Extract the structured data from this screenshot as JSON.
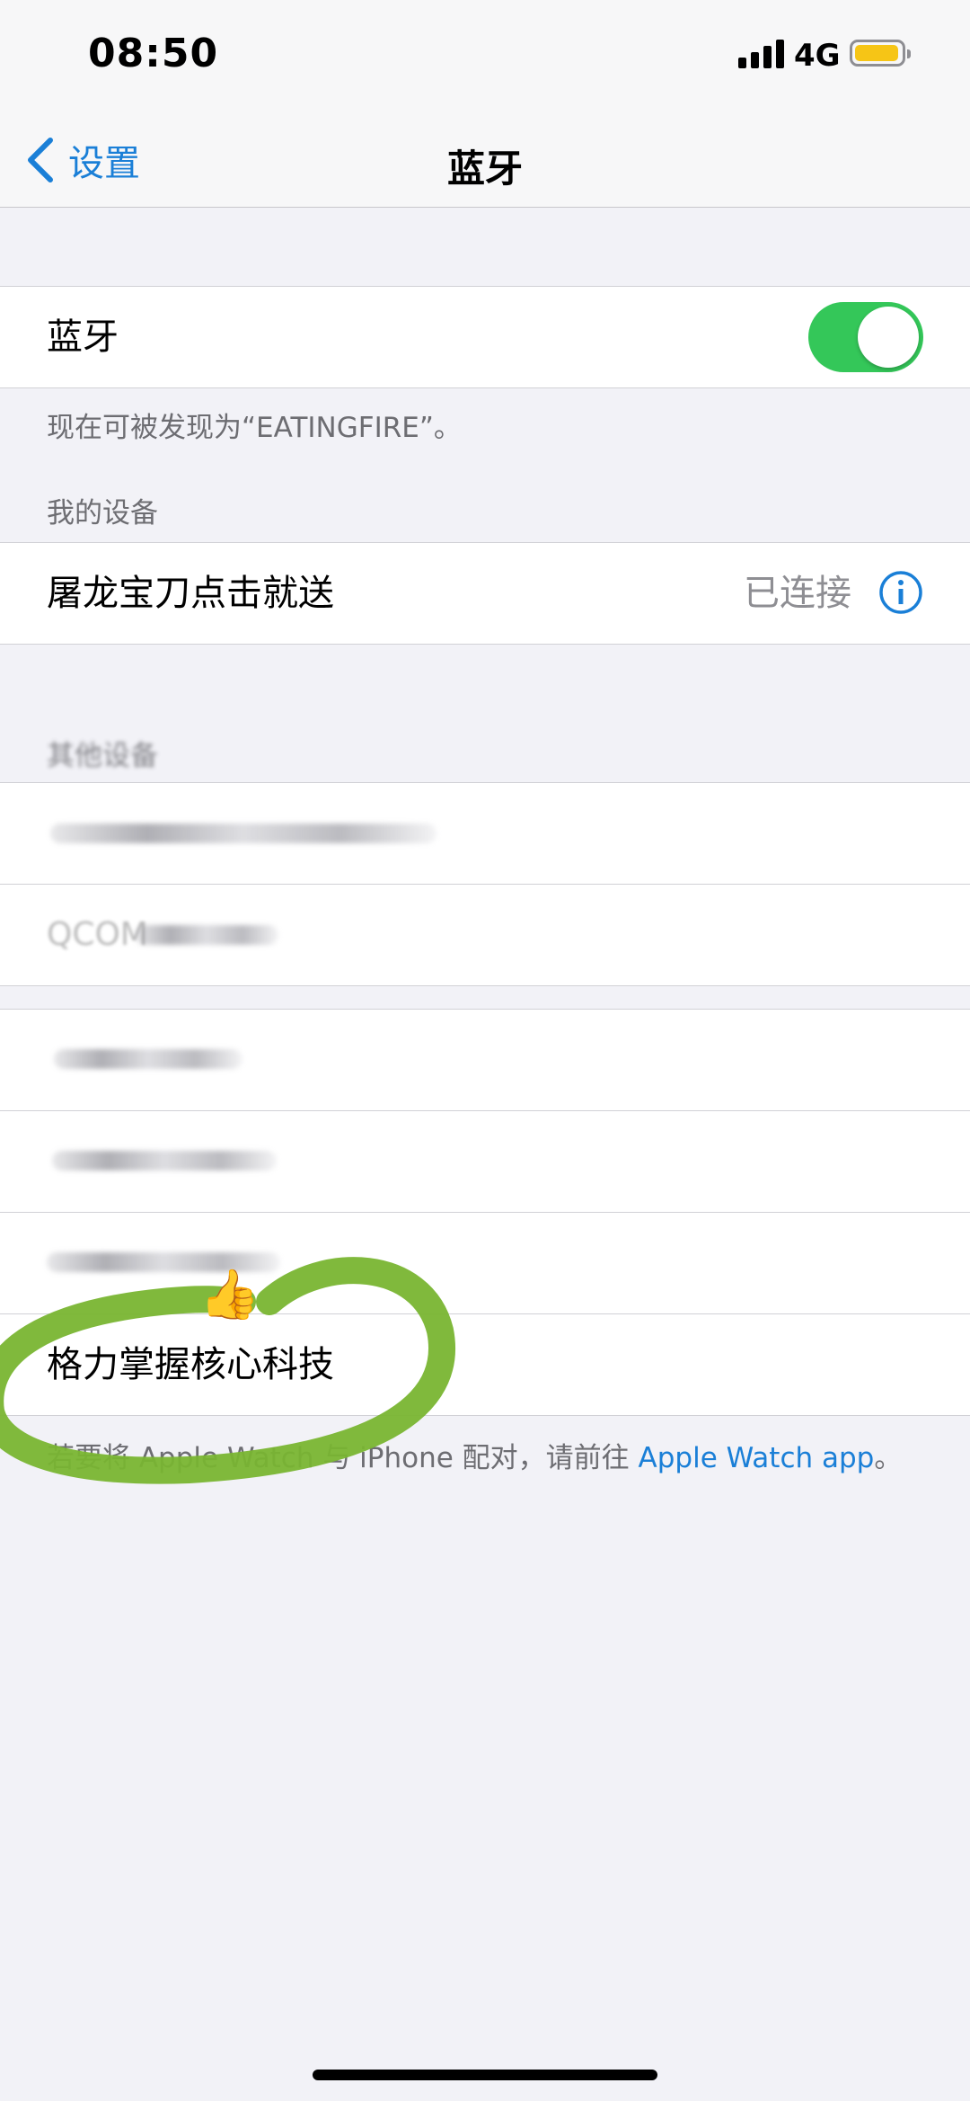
{
  "status_bar": {
    "time": "08:50",
    "network": "4G",
    "battery_color": "#f6c516"
  },
  "nav": {
    "back_label": "设置",
    "title": "蓝牙"
  },
  "bluetooth": {
    "label": "蓝牙",
    "enabled": true,
    "discoverable_text": "现在可被发现为“EATINGFIRE”。"
  },
  "my_devices": {
    "header": "我的设备",
    "items": [
      {
        "name": "屠龙宝刀点击就送",
        "status": "已连接"
      }
    ]
  },
  "other_devices": {
    "header": "其他设备",
    "group1": [
      {
        "name": ""
      },
      {
        "name": "QCOM"
      }
    ],
    "group2": [
      {
        "name": ""
      },
      {
        "name": ""
      },
      {
        "name": ""
      },
      {
        "name": "格力掌握核心科技"
      }
    ]
  },
  "footer": {
    "text": "若要将 Apple Watch 与 iPhone 配对，请前往",
    "link": "Apple Watch app",
    "suffix": "。"
  },
  "colors": {
    "accent": "#1a7fd7",
    "toggle_on": "#34c759",
    "annotation": "#79b531"
  }
}
